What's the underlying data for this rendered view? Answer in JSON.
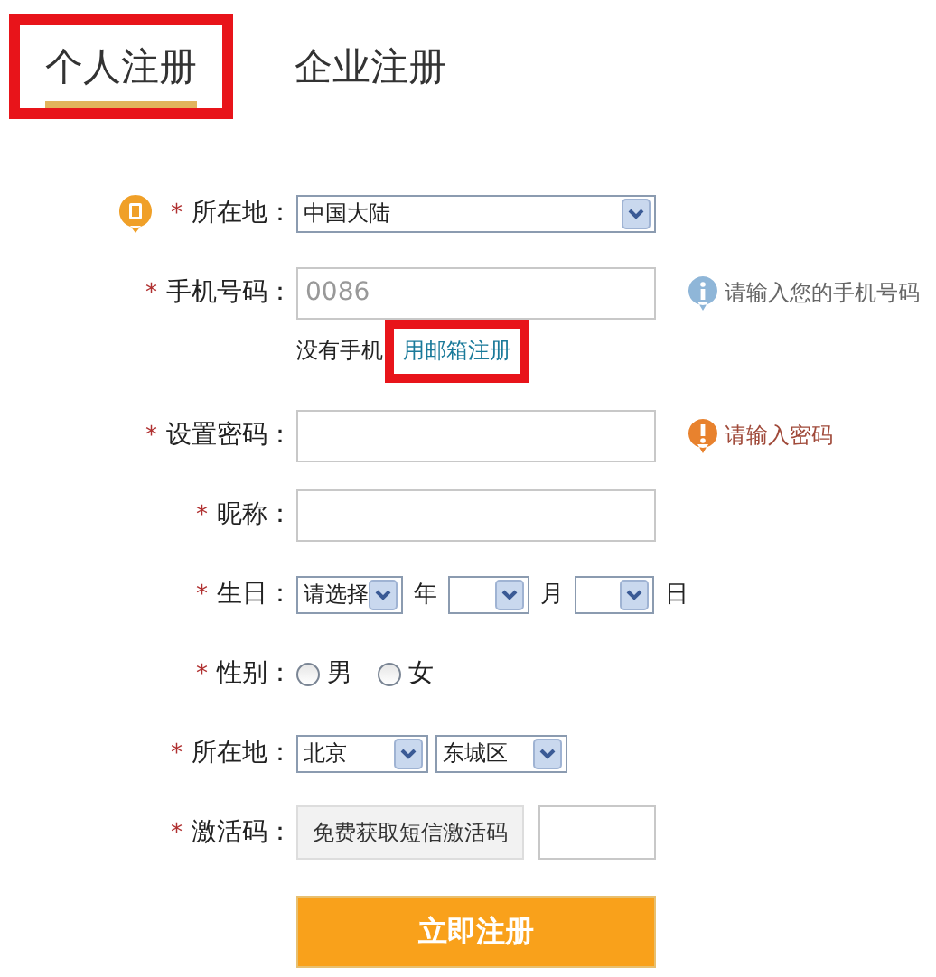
{
  "tabs": [
    {
      "label": "个人注册",
      "selected": true,
      "highlighted": true
    },
    {
      "label": "企业注册",
      "selected": false,
      "highlighted": false
    }
  ],
  "rows": [
    {
      "kind": "select",
      "mark": "*",
      "label": "所在地：",
      "value": "中国大陆"
    },
    {
      "kind": "text",
      "mark": "*",
      "label": "手机号码：",
      "placeholder": "0086",
      "hint": {
        "kind": "info",
        "text": "请输入您的手机号码"
      },
      "note": {
        "text": "没有手机",
        "link": "用邮箱注册",
        "highlighted": true
      }
    },
    {
      "kind": "text",
      "mark": "*",
      "label": "设置密码：",
      "hint": {
        "kind": "warning",
        "text": "请输入密码"
      }
    },
    {
      "kind": "text",
      "mark": "*",
      "label": "昵称："
    },
    {
      "kind": "date",
      "mark": "*",
      "label": "生日：",
      "selects": [
        {
          "value": "请选择",
          "unit": "年"
        },
        {
          "unit": "月"
        },
        {
          "unit": "日"
        }
      ]
    },
    {
      "kind": "radio",
      "mark": "*",
      "label": "性别：",
      "options": [
        {
          "label": "男",
          "selected": false
        },
        {
          "label": "女",
          "selected": false
        }
      ]
    },
    {
      "kind": "selects",
      "mark": "*",
      "label": "所在地：",
      "selects": [
        {
          "value": "北京"
        },
        {
          "value": "东城区"
        }
      ]
    },
    {
      "kind": "code",
      "mark": "*",
      "label": "激活码：",
      "button": "免费获取短信激活码"
    }
  ],
  "submit": "立即注册"
}
